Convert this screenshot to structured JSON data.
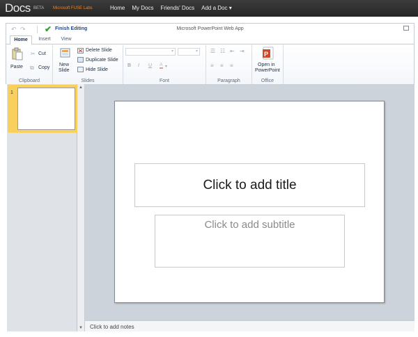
{
  "topbar": {
    "logo": "Docs",
    "beta": "BETA",
    "fuse": "Microsoft FUSE Labs",
    "nav": [
      "Home",
      "My Docs",
      "Friends' Docs",
      "Add a Doc ▾"
    ]
  },
  "qat": {
    "undo_icon": "undo-icon",
    "redo_icon": "redo-icon",
    "finish_editing": "Finish Editing",
    "app_title": "Microsoft PowerPoint Web App"
  },
  "tabs": [
    "Home",
    "Insert",
    "View"
  ],
  "ribbon": {
    "clipboard": {
      "paste": "Paste",
      "cut": "Cut",
      "copy": "Copy",
      "name": "Clipboard"
    },
    "slides": {
      "new_slide_line1": "New",
      "new_slide_line2": "Slide",
      "delete": "Delete Slide",
      "duplicate": "Duplicate Slide",
      "hide": "Hide Slide",
      "name": "Slides"
    },
    "font": {
      "bold": "B",
      "italic": "I",
      "underline": "U",
      "font_color": "A",
      "name": "Font"
    },
    "paragraph": {
      "name": "Paragraph"
    },
    "office": {
      "open_line1": "Open in",
      "open_line2": "PowerPoint",
      "name": "Office"
    }
  },
  "thumbnails": {
    "slide_number": "1"
  },
  "slide": {
    "title_placeholder": "Click to add title",
    "subtitle_placeholder": "Click to add subtitle"
  },
  "notes": {
    "placeholder": "Click to add notes"
  },
  "colors": {
    "topbar": "#2e2e2e",
    "fuse_accent": "#e6892f",
    "selected_thumbnail": "#f9cf5e",
    "finish_check": "#2fa12f"
  }
}
